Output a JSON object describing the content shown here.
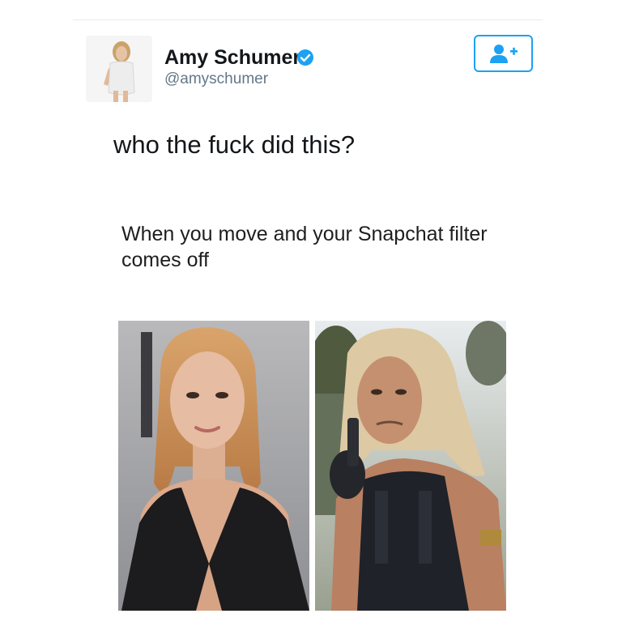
{
  "tweet": {
    "display_name": "Amy Schumer",
    "handle": "@amyschumer",
    "text": "who the fuck did this?",
    "follow_icon": "add-user-icon",
    "verified_icon": "verified-badge-icon",
    "colors": {
      "accent": "#1da1f2",
      "name": "#14171a",
      "handle": "#657786"
    }
  },
  "meme": {
    "caption": "When you move and your Snapchat filter comes off",
    "left_photo": "woman-red-carpet-photo",
    "right_photo": "man-vest-photo"
  }
}
